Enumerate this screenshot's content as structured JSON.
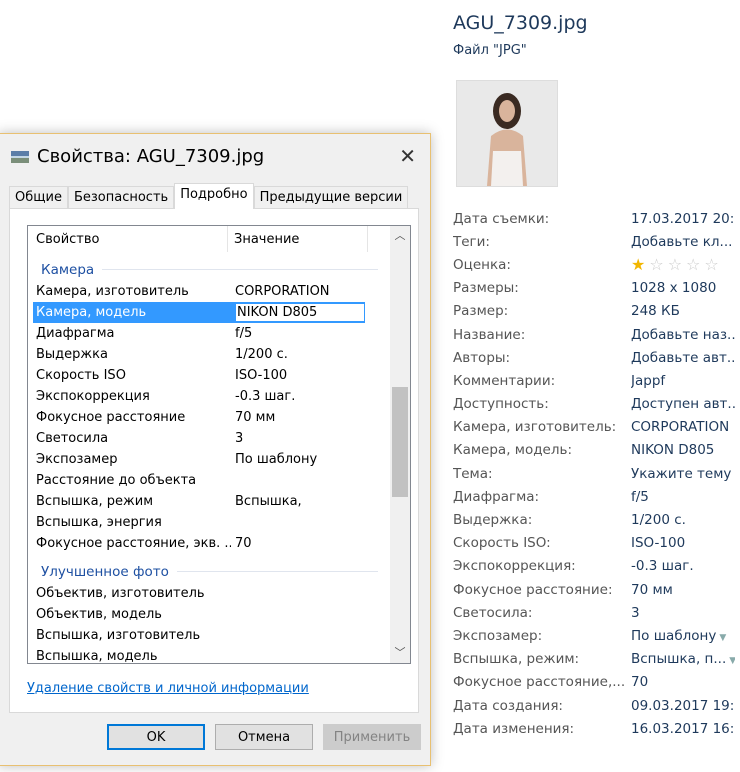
{
  "details_pane": {
    "file_name": "AGU_7309.jpg",
    "file_type": "Файл \"JPG\"",
    "rating": 1,
    "rating_max": 5,
    "properties": [
      {
        "label": "Дата съемки:",
        "value": "17.03.2017 20:..."
      },
      {
        "label": "Теги:",
        "value": "Добавьте кл..."
      },
      {
        "label": "Оценка:",
        "value": ""
      },
      {
        "label": "Размеры:",
        "value": "1028 x 1080"
      },
      {
        "label": "Размер:",
        "value": "248 КБ"
      },
      {
        "label": "Название:",
        "value": "Добавьте наз..."
      },
      {
        "label": "Авторы:",
        "value": "Добавьте авт..."
      },
      {
        "label": "Комментарии:",
        "value": "Jappf"
      },
      {
        "label": "Доступность:",
        "value": "Доступен авт..."
      },
      {
        "label": "Камера, изготовитель:",
        "value": "CORPORATION"
      },
      {
        "label": "Камера, модель:",
        "value": "NIKON D805"
      },
      {
        "label": "Тема:",
        "value": "Укажите тему"
      },
      {
        "label": "Диафрагма:",
        "value": "f/5"
      },
      {
        "label": "Выдержка:",
        "value": "1/200 с."
      },
      {
        "label": "Скорость ISO:",
        "value": "ISO-100"
      },
      {
        "label": "Экспокоррекция:",
        "value": "-0.3 шаг."
      },
      {
        "label": "Фокусное расстояние:",
        "value": "70 мм"
      },
      {
        "label": "Светосила:",
        "value": "3"
      },
      {
        "label": "Экспозамер:",
        "value": "По шаблону"
      },
      {
        "label": "Вспышка, режим:",
        "value": "Вспышка, п..."
      },
      {
        "label": "Фокусное расстояние,...",
        "value": "70"
      },
      {
        "label": "Дата создания:",
        "value": "09.03.2017 19:..."
      },
      {
        "label": "Дата изменения:",
        "value": "16.03.2017 16:..."
      }
    ]
  },
  "dialog": {
    "title": "Свойства: AGU_7309.jpg",
    "close": "✕",
    "tabs": [
      "Общие",
      "Безопасность",
      "Подробно",
      "Предыдущие версии"
    ],
    "active_tab": "Подробно",
    "columns": [
      "Свойство",
      "Значение"
    ],
    "group1": "Камера",
    "group1_rows": [
      [
        "Камера, изготовитель",
        "CORPORATION"
      ],
      [
        "Камера, модель",
        "NIKON D805"
      ],
      [
        "Диафрагма",
        "f/5"
      ],
      [
        "Выдержка",
        "1/200 с."
      ],
      [
        "Скорость ISO",
        "ISO-100"
      ],
      [
        "Экспокоррекция",
        "-0.3 шаг."
      ],
      [
        "Фокусное расстояние",
        "70 мм"
      ],
      [
        "Светосила",
        "3"
      ],
      [
        "Экспозамер",
        "По шаблону"
      ],
      [
        "Расстояние до объекта",
        ""
      ],
      [
        "Вспышка, режим",
        "Вспышка,"
      ],
      [
        "Вспышка, энергия",
        ""
      ],
      [
        "Фокусное расстояние, экв. ...",
        "70"
      ]
    ],
    "group2": "Улучшенное фото",
    "group2_rows": [
      [
        "Объектив, изготовитель",
        ""
      ],
      [
        "Объектив, модель",
        ""
      ],
      [
        "Вспышка, изготовитель",
        ""
      ],
      [
        "Вспышка, модель",
        ""
      ]
    ],
    "link": "Удаление свойств и личной информации",
    "buttons": {
      "ok": "OK",
      "cancel": "Отмена",
      "apply": "Применить"
    }
  }
}
